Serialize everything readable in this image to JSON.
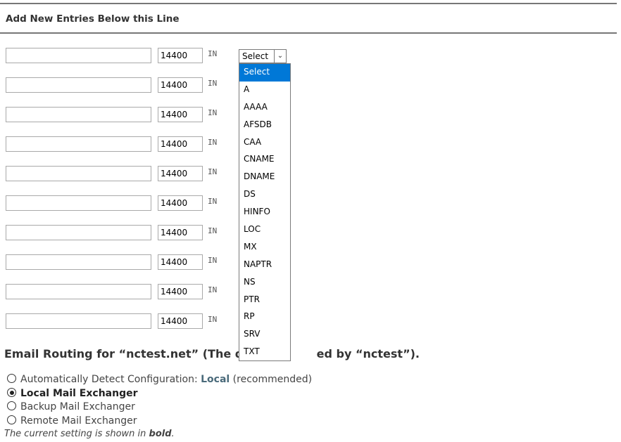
{
  "add_entries": {
    "title": "Add New Entries Below this Line",
    "rows": [
      {
        "name": "",
        "ttl": "14400",
        "class": "IN"
      },
      {
        "name": "",
        "ttl": "14400",
        "class": "IN"
      },
      {
        "name": "",
        "ttl": "14400",
        "class": "IN"
      },
      {
        "name": "",
        "ttl": "14400",
        "class": "IN"
      },
      {
        "name": "",
        "ttl": "14400",
        "class": "IN"
      },
      {
        "name": "",
        "ttl": "14400",
        "class": "IN"
      },
      {
        "name": "",
        "ttl": "14400",
        "class": "IN"
      },
      {
        "name": "",
        "ttl": "14400",
        "class": "IN"
      },
      {
        "name": "",
        "ttl": "14400",
        "class": "IN"
      },
      {
        "name": "",
        "ttl": "14400",
        "class": "IN"
      }
    ],
    "type_select": {
      "value": "Select",
      "options": [
        "Select",
        "A",
        "AAAA",
        "AFSDB",
        "CAA",
        "CNAME",
        "DNAME",
        "DS",
        "HINFO",
        "LOC",
        "MX",
        "NAPTR",
        "NS",
        "PTR",
        "RP",
        "SRV",
        "TXT"
      ],
      "highlighted": "Select",
      "highlight_color": "#0078d7"
    }
  },
  "email_routing": {
    "heading_start": "Email Routing for “nctest.net” (The doma",
    "heading_end": "ed by “nctest”).",
    "options": [
      {
        "label": "Automatically Detect Configuration: ",
        "highlight": "Local",
        "suffix": " (recommended)",
        "checked": false
      },
      {
        "label": "Local Mail Exchanger",
        "checked": true
      },
      {
        "label": "Backup Mail Exchanger",
        "checked": false
      },
      {
        "label": "Remote Mail Exchanger",
        "checked": false
      }
    ],
    "footnote_prefix": "The current setting is shown in ",
    "footnote_bold": "bold",
    "footnote_suffix": "."
  }
}
